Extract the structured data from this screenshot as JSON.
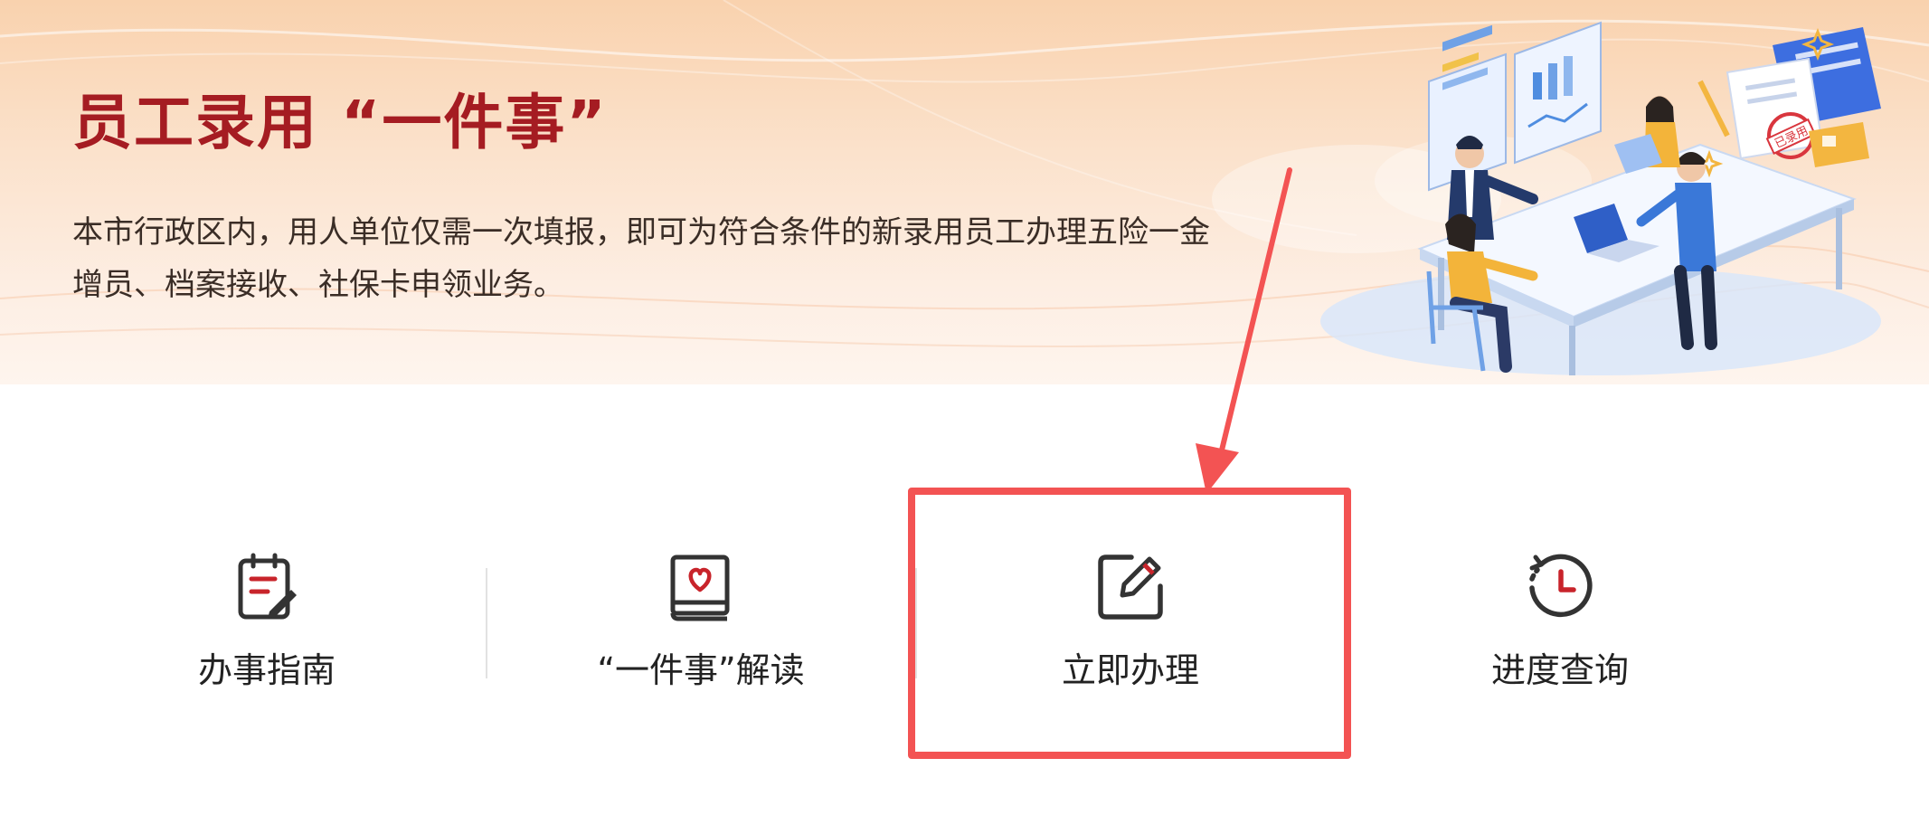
{
  "banner": {
    "title": "员工录用 “一件事”",
    "description": "本市行政区内，用人单位仅需一次填报，即可为符合条件的新录用员工办理五险一金增员、档案接收、社保卡申领业务。",
    "stamp_text": "已录用"
  },
  "actions": [
    {
      "label": "办事指南",
      "icon": "guide-clipboard-icon"
    },
    {
      "label": "“一件事”解读",
      "icon": "book-heart-icon"
    },
    {
      "label": "立即办理",
      "icon": "edit-pencil-icon"
    },
    {
      "label": "进度查询",
      "icon": "history-clock-icon"
    }
  ],
  "colors": {
    "brand_red": "#a51c22",
    "highlight": "#f35353",
    "icon_dark": "#333333",
    "icon_accent": "#c8242b"
  }
}
